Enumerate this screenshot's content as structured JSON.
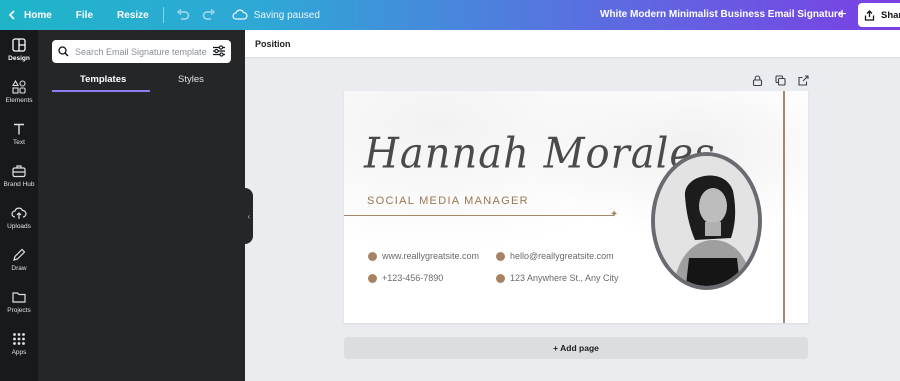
{
  "topbar": {
    "home_label": "Home",
    "file_label": "File",
    "resize_label": "Resize",
    "save_status": "Saving paused",
    "title": "White Modern Minimalist Business Email Signature",
    "share_label": "Share",
    "gradient_start": "#1fb5c9",
    "gradient_end": "#7b3fe4"
  },
  "leftnav": {
    "items": [
      {
        "label": "Design",
        "icon": "layout-icon"
      },
      {
        "label": "Elements",
        "icon": "shapes-icon"
      },
      {
        "label": "Text",
        "icon": "text-icon"
      },
      {
        "label": "Brand Hub",
        "icon": "briefcase-icon"
      },
      {
        "label": "Uploads",
        "icon": "cloud-upload-icon"
      },
      {
        "label": "Draw",
        "icon": "pen-icon"
      },
      {
        "label": "Projects",
        "icon": "folder-icon"
      },
      {
        "label": "Apps",
        "icon": "grid-icon"
      }
    ]
  },
  "panel": {
    "search_placeholder": "Search Email Signature templates",
    "tabs": [
      "Templates",
      "Styles"
    ],
    "active_tab": "Templates"
  },
  "workspace": {
    "position_label": "Position",
    "add_page_label": "+ Add page"
  },
  "signature": {
    "name": "Hannah Morales",
    "job_title": "SOCIAL MEDIA MANAGER",
    "website": "www.reallygreatsite.com",
    "email": "hello@reallygreatsite.com",
    "phone": "+123-456-7890",
    "address": "123 Anywhere St., Any City",
    "accent_color": "#a58866"
  }
}
